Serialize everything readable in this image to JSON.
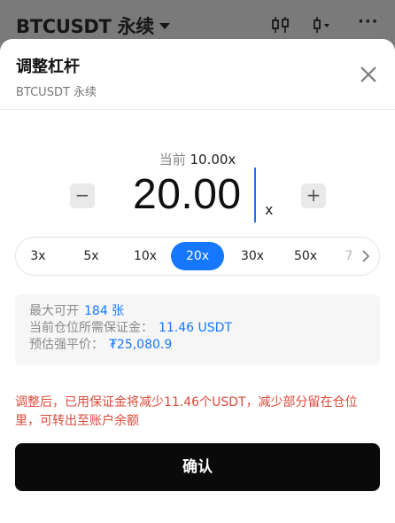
{
  "topbar": {
    "symbol": "BTCUSDT 永续",
    "icons": [
      "candlestick-chart-icon",
      "kline-settings-icon",
      "more-icon"
    ],
    "more": "···"
  },
  "sheet": {
    "title": "调整杠杆",
    "subtitle": "BTCUSDT 永续"
  },
  "leverage": {
    "current_label": "当前",
    "current_value": "10.00x",
    "value": "20.00",
    "unit": "x",
    "minus": "−",
    "plus": "+"
  },
  "presets": [
    {
      "label": "3x",
      "active": false
    },
    {
      "label": "5x",
      "active": false
    },
    {
      "label": "10x",
      "active": false
    },
    {
      "label": "20x",
      "active": true
    },
    {
      "label": "30x",
      "active": false
    },
    {
      "label": "50x",
      "active": false
    },
    {
      "label": "7",
      "active": false
    }
  ],
  "info": {
    "max_open_label": "最大可开",
    "max_open_value": "184 张",
    "margin_label": "当前仓位所需保证金：",
    "margin_value": "11.46 USDT",
    "liq_label": "预估强平价：",
    "liq_value": "₮25,080.9"
  },
  "warning": "调整后，已用保证金将减少11.46个USDT，减少部分留在仓位里，可转出至账户余额",
  "confirm_label": "确认",
  "colors": {
    "accent": "#1677ff",
    "warning": "#d84a3a",
    "button_bg": "#0a0a0a"
  }
}
